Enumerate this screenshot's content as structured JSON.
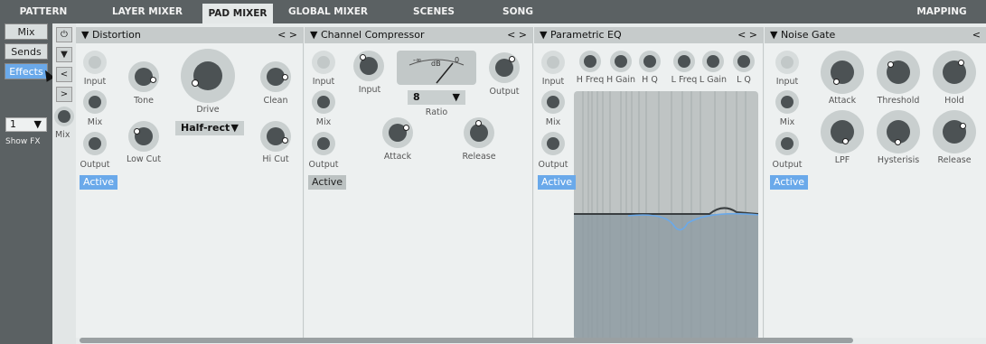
{
  "tabs": [
    "PATTERN",
    "LAYER MIXER",
    "PAD MIXER",
    "GLOBAL MIXER",
    "SCENES",
    "SONG",
    "MAPPING"
  ],
  "left_buttons": [
    "Mix",
    "Sends",
    "Effects"
  ],
  "fx_count": "1",
  "show_fx": "Show FX",
  "mini": {
    "power": "⏻",
    "down": "▼",
    "left": "<",
    "right": ">",
    "mix": "Mix"
  },
  "distortion": {
    "title": "▼ Distortion",
    "arrows": "< >",
    "input": "Input",
    "mix": "Mix",
    "output": "Output",
    "tone": "Tone",
    "low_cut": "Low Cut",
    "drive": "Drive",
    "mode": "Half-rect",
    "clean": "Clean",
    "hi_cut": "Hi Cut",
    "active": "Active"
  },
  "compressor": {
    "title": "▼ Channel Compressor",
    "arrows": "< >",
    "input": "Input",
    "mix": "Mix",
    "output": "Output",
    "input2": "Input",
    "ratio_value": "8",
    "ratio": "Ratio",
    "output2": "Output",
    "attack": "Attack",
    "release": "Release",
    "active": "Active",
    "meter_minus_inf": "-∞",
    "meter_db": "dB",
    "meter_zero": "0"
  },
  "eq": {
    "title": "▼ Parametric EQ",
    "arrows": "< >",
    "input": "Input",
    "mix": "Mix",
    "output": "Output",
    "h_freq": "H Freq",
    "h_gain": "H Gain",
    "h_q": "H Q",
    "l_freq": "L Freq",
    "l_gain": "L Gain",
    "l_q": "L Q",
    "active": "Active"
  },
  "gate": {
    "title": "▼ Noise Gate",
    "arrows": "<",
    "input": "Input",
    "mix": "Mix",
    "output": "Output",
    "attack": "Attack",
    "threshold": "Threshold",
    "hold": "Hold",
    "lpf": "LPF",
    "hysterisis": "Hysterisis",
    "release": "Release",
    "active": "Active"
  },
  "colors": {
    "accent": "#6aa9ea",
    "chrome": "#5b6163"
  }
}
